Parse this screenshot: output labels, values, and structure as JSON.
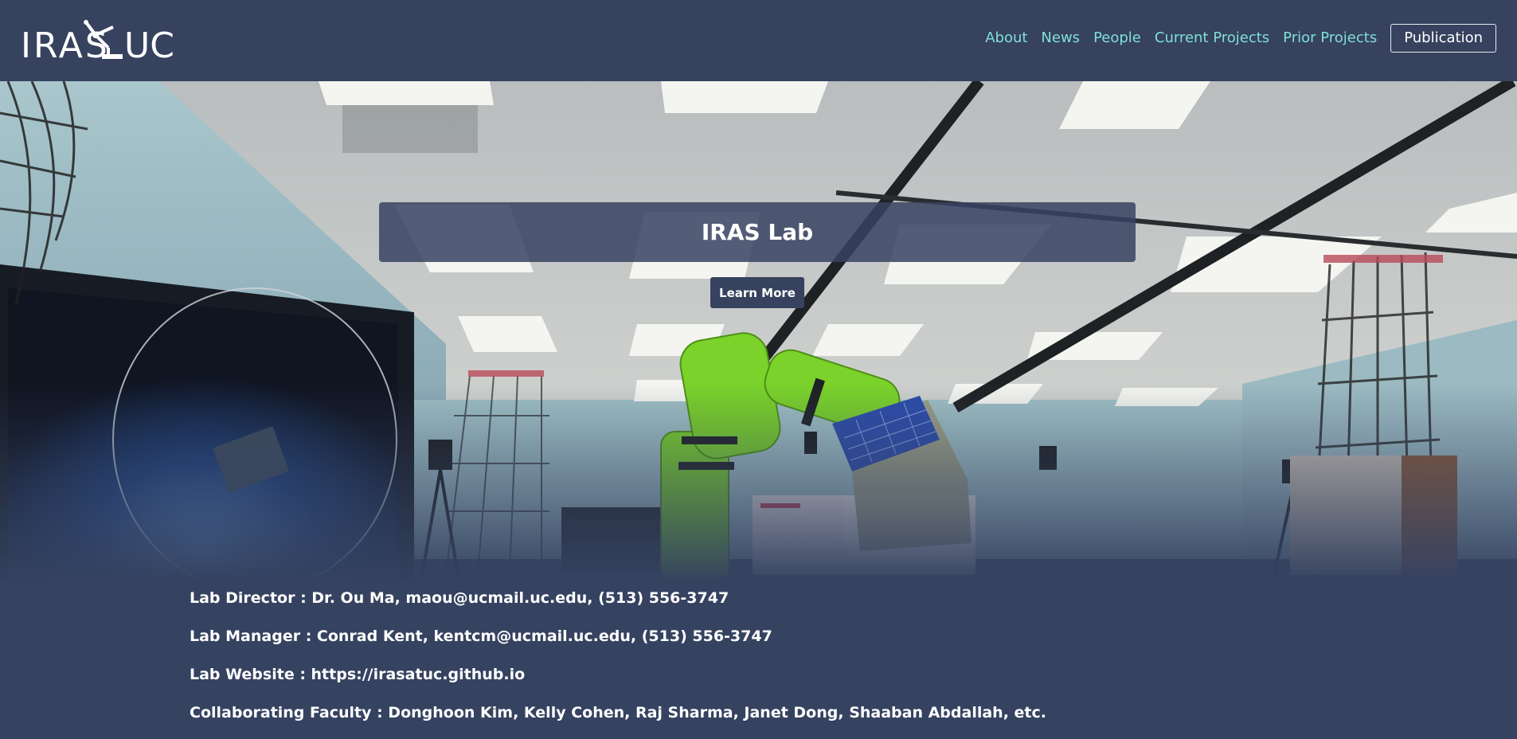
{
  "brand": {
    "logo_text": "IRASUC"
  },
  "nav": {
    "items": [
      {
        "label": "About"
      },
      {
        "label": "News"
      },
      {
        "label": "People"
      },
      {
        "label": "Current Projects"
      },
      {
        "label": "Prior Projects"
      }
    ],
    "publication_button": "Publication"
  },
  "hero": {
    "title": "IRAS Lab",
    "button_label": "Learn More"
  },
  "info": {
    "lines": [
      "Lab Director : Dr. Ou Ma, maou@ucmail.uc.edu, (513) 556-3747",
      "Lab Manager : Conrad Kent, kentcm@ucmail.uc.edu, (513) 556-3747",
      "Lab Website : https://irasatuc.github.io",
      "Collaborating Faculty : Donghoon Kim, Kelly Cohen, Raj Sharma, Janet Dong, Shaaban Abdallah, etc."
    ]
  },
  "colors": {
    "background": "#354260",
    "nav_link": "#7fe0d6",
    "robot_arm": "#7ad22a"
  }
}
